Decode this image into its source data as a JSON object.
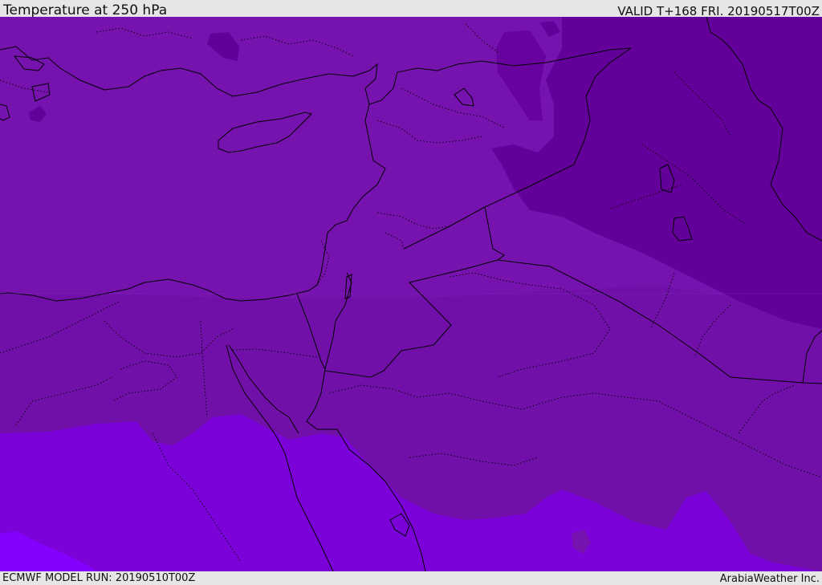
{
  "header": {
    "title": "Temperature at 250 hPa",
    "valid": "VALID T+168 FRI. 20190517T00Z"
  },
  "footer": {
    "model_run": "ECMWF MODEL RUN: 20190510T00Z",
    "credit": "ArabiaWeather Inc."
  },
  "map": {
    "colors": {
      "band_dark": "#64009a",
      "band_mid": "#6e0aa6",
      "band_main": "#7612ae",
      "band_warm": "#7c00da",
      "band_warmer": "#8200ff",
      "border": "#000000"
    }
  }
}
